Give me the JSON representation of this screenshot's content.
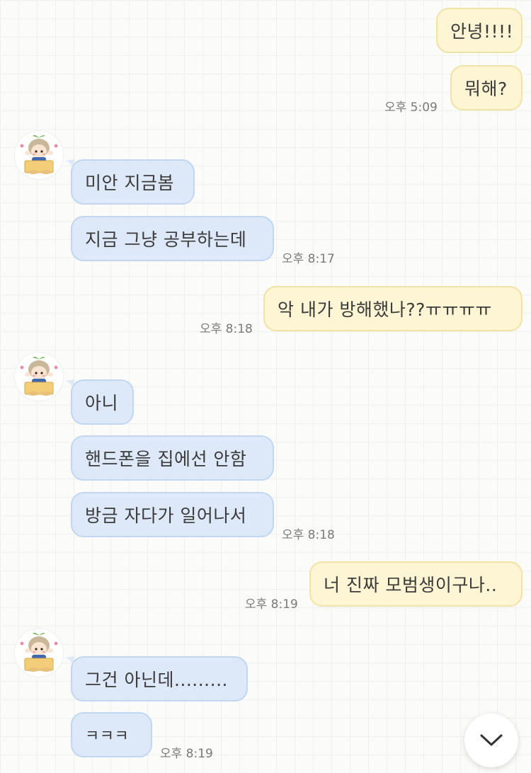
{
  "messages": {
    "m1": {
      "text": "안녕!!!!"
    },
    "m2": {
      "text": "뭐해?",
      "time": "오후 5:09"
    },
    "m3": {
      "text": "미안 지금봄"
    },
    "m4": {
      "text": "지금 그냥 공부하는데",
      "time": "오후 8:17"
    },
    "m5": {
      "text": "악 내가 방해했나??ㅠㅠㅠㅠ",
      "time": "오후 8:18"
    },
    "m6": {
      "text": "아니"
    },
    "m7": {
      "text": "핸드폰을 집에선 안함"
    },
    "m8": {
      "text": "방금 자다가 일어나서",
      "time": "오후 8:18"
    },
    "m9": {
      "text": "너 진짜 모범생이구나..",
      "time": "오후 8:19"
    },
    "m10": {
      "text": "그건 아닌데........."
    },
    "m11": {
      "text": "ㅋㅋㅋ",
      "time": "오후 8:19"
    }
  },
  "icons": {
    "avatar": "character-avatar-icon",
    "scroll_down": "chevron-down-icon"
  },
  "colors": {
    "my_bubble": "#fdf5d3",
    "my_bubble_border": "#f1e3a4",
    "their_bubble": "#dde9f9",
    "their_bubble_border": "#c0d6f1",
    "background": "#fbfbf9"
  }
}
